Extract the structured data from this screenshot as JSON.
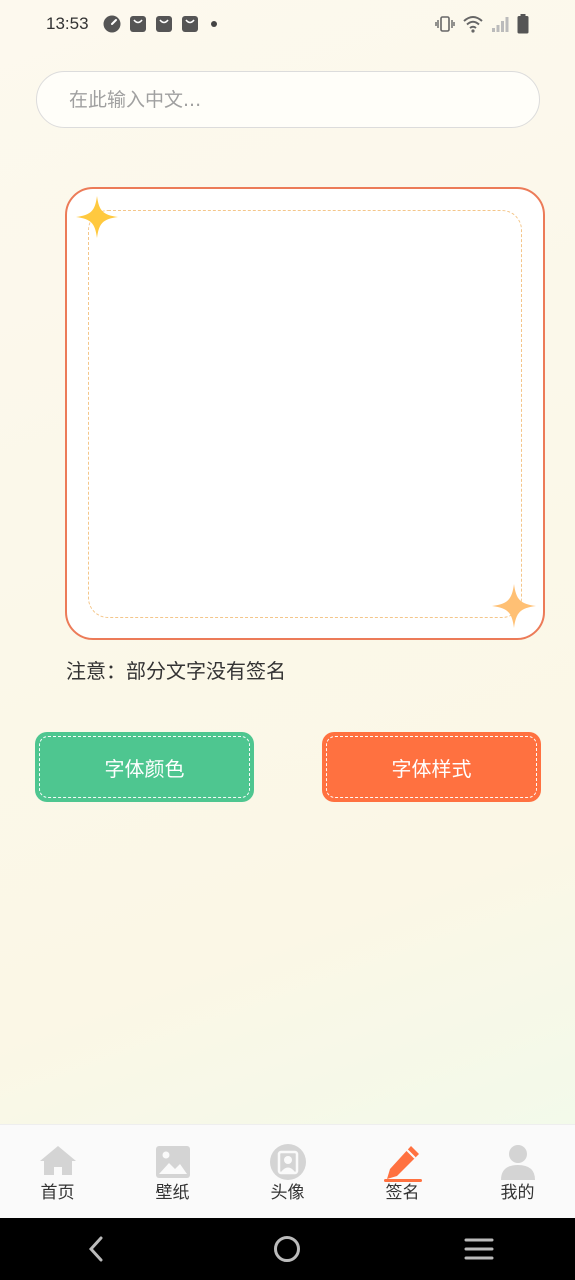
{
  "status_bar": {
    "time": "13:53",
    "icons": [
      "gauge-icon",
      "bag-icon",
      "bag-icon",
      "bag-icon",
      "dot-icon"
    ],
    "right_icons": [
      "vibrate-icon",
      "wifi-icon",
      "signal-icon",
      "battery-icon"
    ]
  },
  "search": {
    "placeholder": "在此输入中文...",
    "value": ""
  },
  "signature_area": {
    "sparkle_color_top": "#ffc93f",
    "sparkle_color_bottom": "#ffc074",
    "frame_color": "#ec7b58"
  },
  "notice": {
    "text": "注意：部分文字没有签名"
  },
  "buttons": {
    "font_color_label": "字体颜色",
    "font_style_label": "字体样式",
    "font_color_bg": "#4ec690",
    "font_style_bg": "#ff7140"
  },
  "tabbar": {
    "active_index": 3,
    "active_color": "#ff7140",
    "items": [
      {
        "label": "首页",
        "icon": "home-icon"
      },
      {
        "label": "壁纸",
        "icon": "image-icon"
      },
      {
        "label": "头像",
        "icon": "portrait-icon"
      },
      {
        "label": "签名",
        "icon": "pencil-icon"
      },
      {
        "label": "我的",
        "icon": "user-icon"
      }
    ]
  },
  "navbar": {
    "icons": [
      "back-icon",
      "home-circle-icon",
      "menu-icon"
    ]
  }
}
